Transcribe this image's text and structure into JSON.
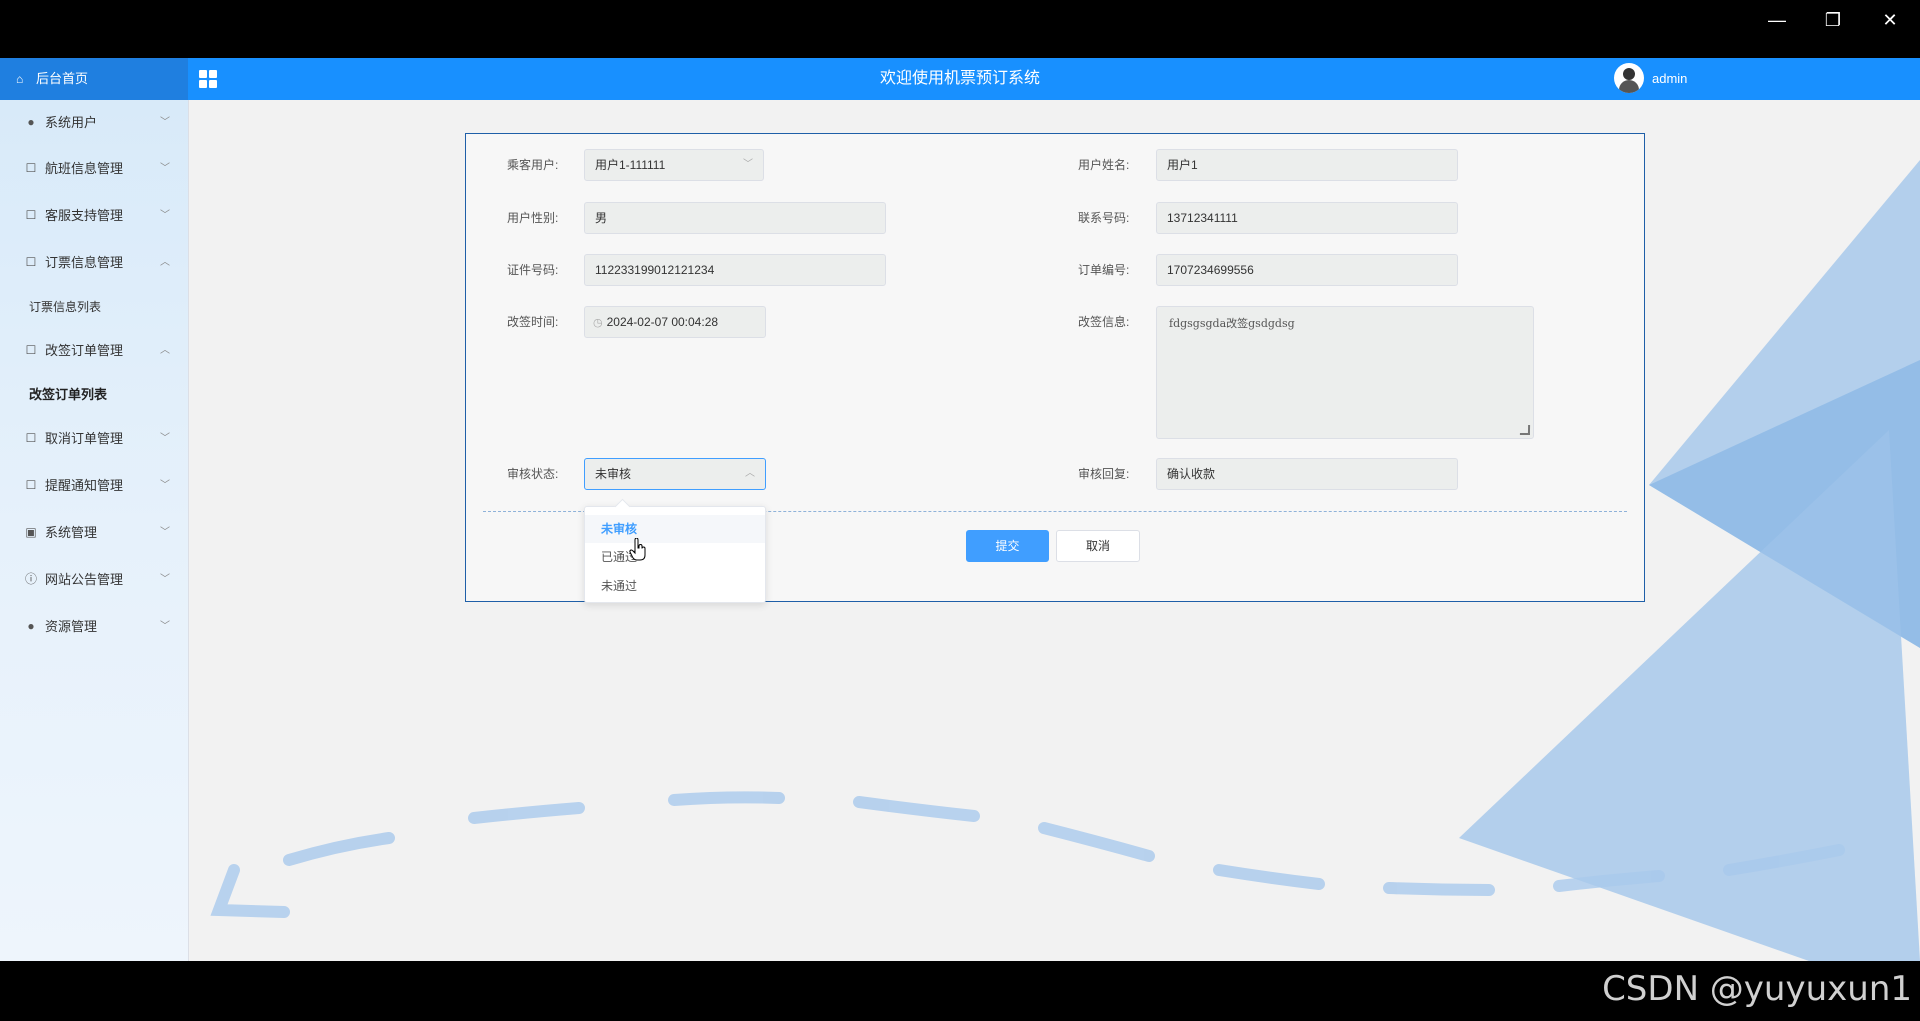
{
  "window_controls": {
    "minimize_icon": "minimize-icon",
    "restore_icon": "restore-icon",
    "close_icon": "close-icon",
    "minimize": "—",
    "restore": "❐",
    "close": "✕"
  },
  "header": {
    "home_label": "后台首页",
    "title": "欢迎使用机票预订系统",
    "user": "admin"
  },
  "sidebar": {
    "items": [
      {
        "label": "系统用户",
        "icon": "user-icon",
        "arrow": "﹀"
      },
      {
        "label": "航班信息管理",
        "icon": "edit-icon",
        "arrow": "﹀"
      },
      {
        "label": "客服支持管理",
        "icon": "edit-icon",
        "arrow": "﹀"
      },
      {
        "label": "订票信息管理",
        "icon": "edit-icon",
        "arrow": "︿"
      },
      {
        "label": "订票信息列表",
        "sub": true
      },
      {
        "label": "改签订单管理",
        "icon": "edit-icon",
        "arrow": "︿"
      },
      {
        "label": "改签订单列表",
        "sub": true,
        "active": true
      },
      {
        "label": "取消订单管理",
        "icon": "edit-icon",
        "arrow": "﹀"
      },
      {
        "label": "提醒通知管理",
        "icon": "edit-icon",
        "arrow": "﹀"
      },
      {
        "label": "系统管理",
        "icon": "image-icon",
        "arrow": "﹀"
      },
      {
        "label": "网站公告管理",
        "icon": "info-icon",
        "arrow": "﹀"
      },
      {
        "label": "资源管理",
        "icon": "location-icon",
        "arrow": "﹀"
      }
    ]
  },
  "form": {
    "passenger_user": {
      "label": "乘客用户:",
      "value": "用户1-111111"
    },
    "user_name": {
      "label": "用户姓名:",
      "value": "用户1"
    },
    "gender": {
      "label": "用户性别:",
      "value": "男"
    },
    "phone": {
      "label": "联系号码:",
      "value": "13712341111"
    },
    "id_number": {
      "label": "证件号码:",
      "value": "112233199012121234"
    },
    "order_no": {
      "label": "订单编号:",
      "value": "1707234699556"
    },
    "change_time": {
      "label": "改签时间:",
      "value": "2024-02-07 00:04:28"
    },
    "change_info": {
      "label": "改签信息:",
      "value": "fdgsgsgda改签gsdgdsg"
    },
    "review_status": {
      "label": "审核状态:",
      "value": "未审核"
    },
    "review_reply": {
      "label": "审核回复:",
      "value": "确认收款"
    },
    "submit": "提交",
    "cancel": "取消"
  },
  "dropdown": {
    "options": [
      "未审核",
      "已通过",
      "未通过"
    ],
    "selected": "未审核"
  },
  "watermark": "CSDN @yuyuxun1",
  "colors": {
    "header": "#1890ff",
    "accent": "#409eff",
    "card_border": "#1f5fa8"
  }
}
